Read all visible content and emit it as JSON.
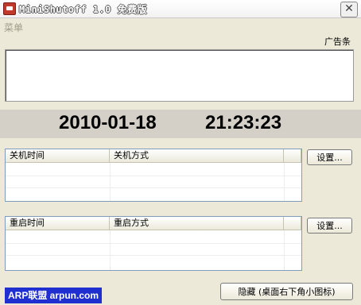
{
  "window": {
    "title": "MiniShutoff 1.0 免费版",
    "close_symbol": "✕"
  },
  "menu": {
    "items": [
      "菜单"
    ]
  },
  "ad": {
    "label": "广告条"
  },
  "clock": {
    "date": "2010-01-18",
    "time": "21:23:23"
  },
  "shutdown": {
    "columns": [
      "关机时间",
      "关机方式"
    ],
    "settings_label": "设置..."
  },
  "restart": {
    "columns": [
      "重启时间",
      "重启方式"
    ],
    "settings_label": "设置..."
  },
  "footer": {
    "hide_label": "隐藏 (桌面右下角小图标)",
    "watermark": "ARP联盟 arpun.com"
  },
  "colors": {
    "watermark_bg": "#1f2fd0",
    "clock_bar_bg": "#d4d0c8",
    "window_bg": "#ece9d8"
  }
}
